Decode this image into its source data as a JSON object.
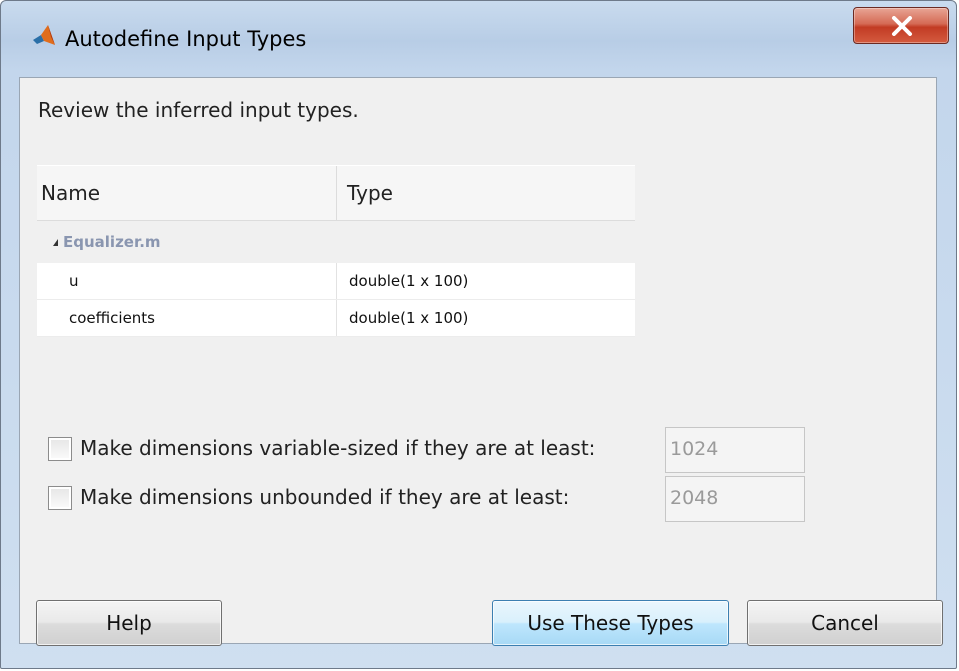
{
  "window": {
    "title": "Autodefine Input Types",
    "close_label": "X"
  },
  "instruction": "Review the inferred input types.",
  "table": {
    "columns": [
      "Name",
      "Type"
    ],
    "group": "Equalizer.m",
    "rows": [
      {
        "name": "u",
        "type": "double(1 x 100)"
      },
      {
        "name": "coefficients",
        "type": "double(1 x 100)"
      }
    ]
  },
  "options": [
    {
      "label": "Make dimensions variable-sized if they are at least:",
      "checked": false,
      "value": "1024"
    },
    {
      "label": "Make dimensions unbounded if they are at least:",
      "checked": false,
      "value": "2048"
    }
  ],
  "buttons": {
    "help": "Help",
    "use_types": "Use These Types",
    "cancel": "Cancel"
  },
  "colors": {
    "title_background": "#c9dbee",
    "close_button": "#c23b24",
    "default_button_border": "#3c7fb1",
    "group_label": "#8a96b0"
  },
  "icons": {
    "app": "matlab-logo-icon",
    "close": "close-icon",
    "expand": "triangle-expanded-icon"
  }
}
